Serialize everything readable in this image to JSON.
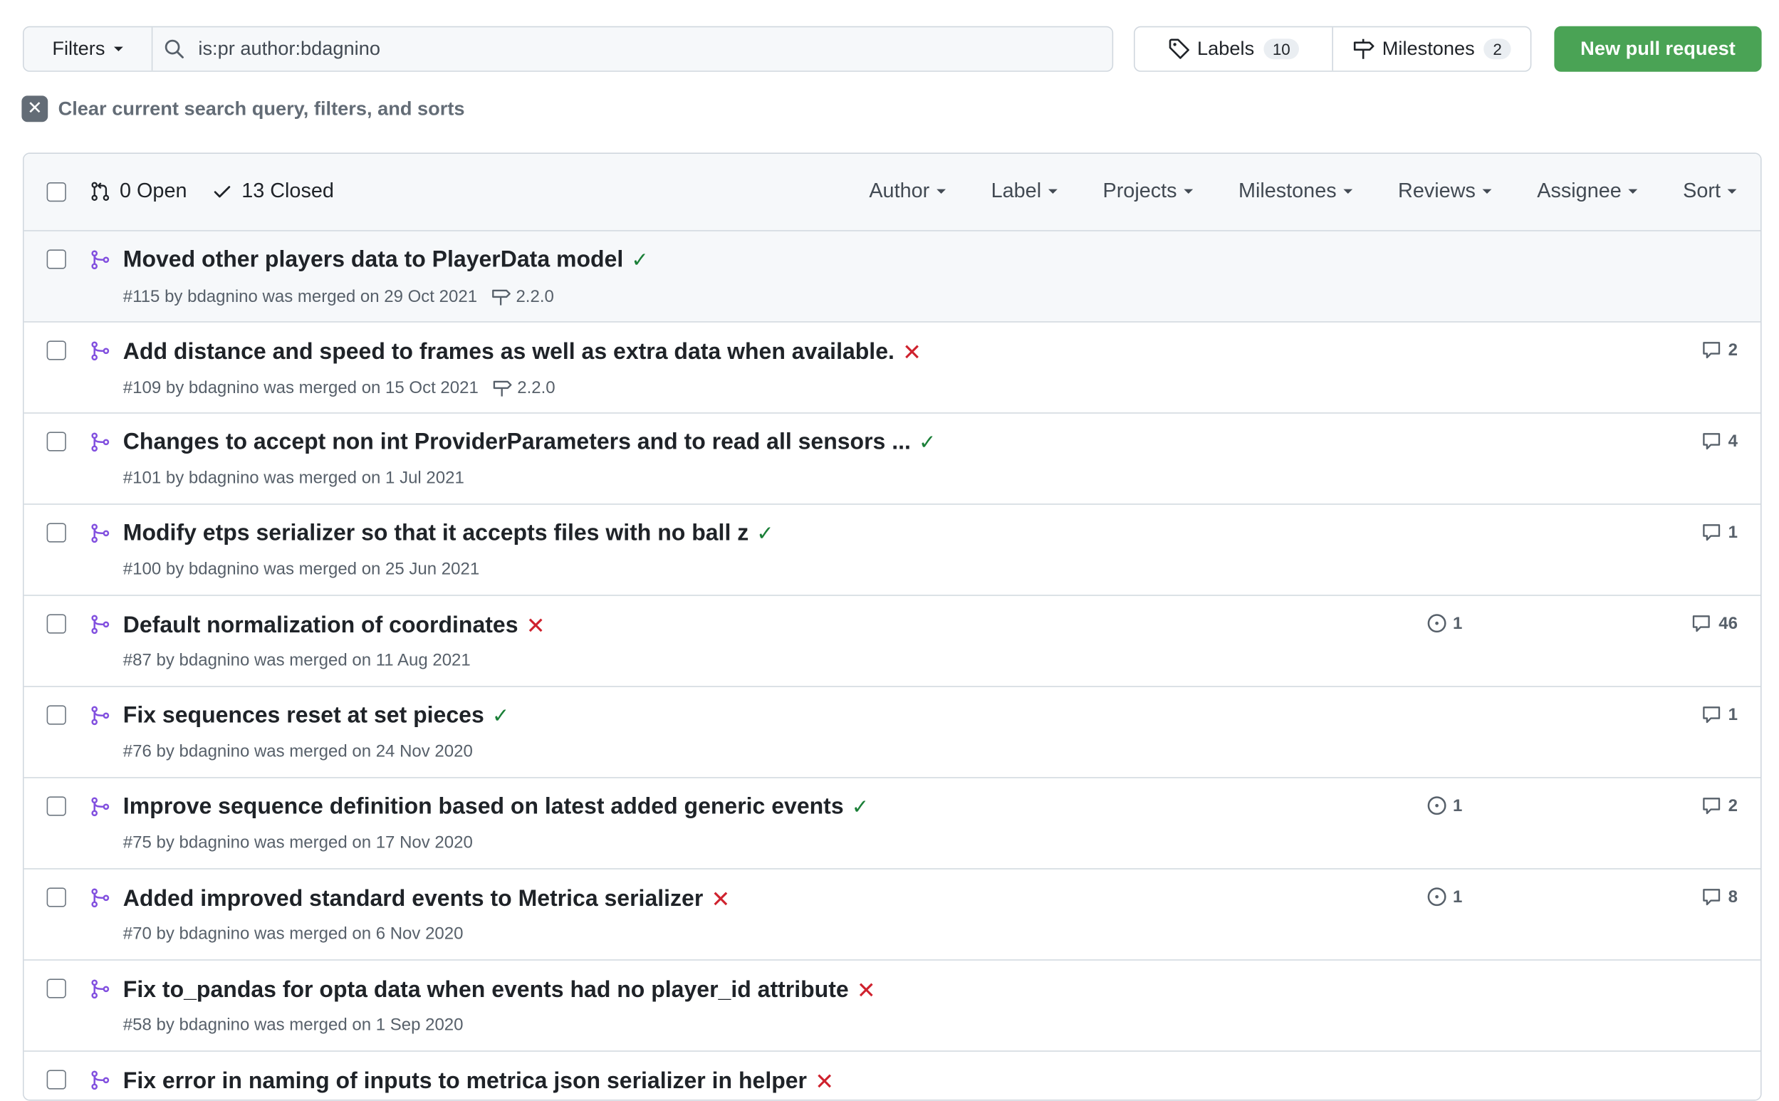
{
  "toolbar": {
    "filters_label": "Filters",
    "search_value": "is:pr author:bdagnino",
    "labels_label": "Labels",
    "labels_count": "10",
    "milestones_label": "Milestones",
    "milestones_count": "2",
    "new_pr_label": "New pull request"
  },
  "clear": {
    "label": "Clear current search query, filters, and sorts"
  },
  "list_header": {
    "open_label": "0 Open",
    "closed_label": "13 Closed",
    "filters": [
      "Author",
      "Label",
      "Projects",
      "Milestones",
      "Reviews",
      "Assignee",
      "Sort"
    ]
  },
  "colors": {
    "merged": "#8250df",
    "success": "#1a7f37",
    "failure": "#cf222e",
    "primary_button": "#4aa355"
  },
  "prs": [
    {
      "title": "Moved other players data to PlayerData model",
      "status": "success",
      "meta": "#115 by bdagnino was merged on 29 Oct 2021",
      "milestone": "2.2.0",
      "issues": "",
      "comments": ""
    },
    {
      "title": "Add distance and speed to frames as well as extra data when available.",
      "status": "failure",
      "meta": "#109 by bdagnino was merged on 15 Oct 2021",
      "milestone": "2.2.0",
      "issues": "",
      "comments": "2"
    },
    {
      "title": "Changes to accept non int ProviderParameters and to read all sensors ...",
      "status": "success",
      "meta": "#101 by bdagnino was merged on 1 Jul 2021",
      "milestone": "",
      "issues": "",
      "comments": "4"
    },
    {
      "title": "Modify etps serializer so that it accepts files with no ball z",
      "status": "success",
      "meta": "#100 by bdagnino was merged on 25 Jun 2021",
      "milestone": "",
      "issues": "",
      "comments": "1"
    },
    {
      "title": "Default normalization of coordinates",
      "status": "failure",
      "meta": "#87 by bdagnino was merged on 11 Aug 2021",
      "milestone": "",
      "issues": "1",
      "comments": "46"
    },
    {
      "title": "Fix sequences reset at set pieces",
      "status": "success",
      "meta": "#76 by bdagnino was merged on 24 Nov 2020",
      "milestone": "",
      "issues": "",
      "comments": "1"
    },
    {
      "title": "Improve sequence definition based on latest added generic events",
      "status": "success",
      "meta": "#75 by bdagnino was merged on 17 Nov 2020",
      "milestone": "",
      "issues": "1",
      "comments": "2"
    },
    {
      "title": "Added improved standard events to Metrica serializer",
      "status": "failure",
      "meta": "#70 by bdagnino was merged on 6 Nov 2020",
      "milestone": "",
      "issues": "1",
      "comments": "8"
    },
    {
      "title": "Fix to_pandas for opta data when events had no player_id attribute",
      "status": "failure",
      "meta": "#58 by bdagnino was merged on 1 Sep 2020",
      "milestone": "",
      "issues": "",
      "comments": ""
    },
    {
      "title": "Fix error in naming of inputs to metrica json serializer in helper",
      "status": "failure",
      "meta": "",
      "milestone": "",
      "issues": "",
      "comments": ""
    }
  ]
}
